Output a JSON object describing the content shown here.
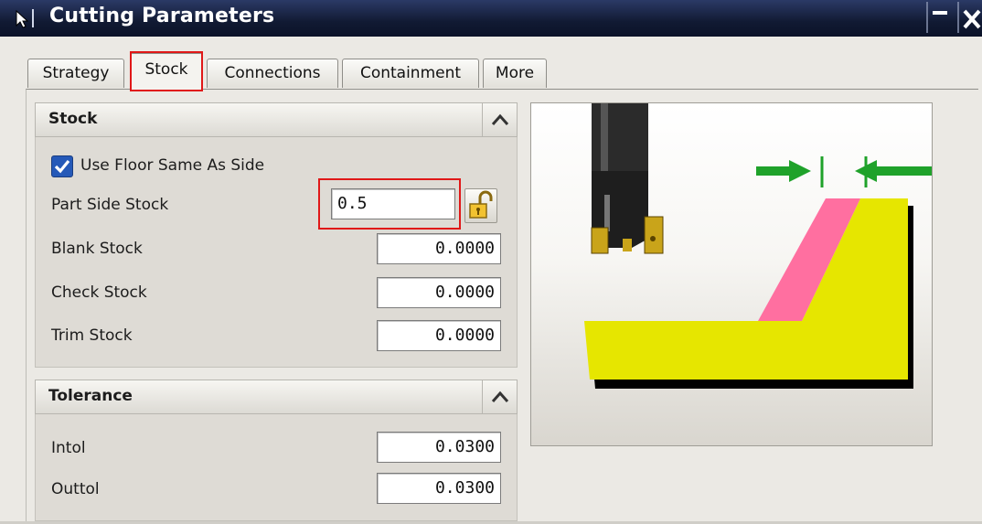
{
  "window": {
    "title": "Cutting Parameters"
  },
  "tabs": [
    {
      "label": "Strategy",
      "active": false
    },
    {
      "label": "Stock",
      "active": true
    },
    {
      "label": "Connections",
      "active": false
    },
    {
      "label": "Containment",
      "active": false
    },
    {
      "label": "More",
      "active": false
    }
  ],
  "stock_group": {
    "title": "Stock",
    "use_floor_same_as_side": {
      "label": "Use Floor Same As Side",
      "checked": true
    },
    "part_side_stock": {
      "label": "Part Side Stock",
      "value": "0.5"
    },
    "blank_stock": {
      "label": "Blank Stock",
      "value": "0.0000"
    },
    "check_stock": {
      "label": "Check Stock",
      "value": "0.0000"
    },
    "trim_stock": {
      "label": "Trim Stock",
      "value": "0.0000"
    }
  },
  "tolerance_group": {
    "title": "Tolerance",
    "intol": {
      "label": "Intol",
      "value": "0.0300"
    },
    "outtol": {
      "label": "Outtol",
      "value": "0.0300"
    }
  },
  "icons": {
    "app": "cursor-arrow-icon",
    "minimize": "minimize-icon",
    "close": "close-icon",
    "collapse": "chevron-up-icon",
    "lock": "unlocked-padlock-icon"
  },
  "colors": {
    "highlight": "#e01818",
    "part_fill": "#e6e600",
    "stock_fill": "#ff6fa0",
    "arrow": "#1fa22a",
    "checkbox": "#2559b8"
  }
}
